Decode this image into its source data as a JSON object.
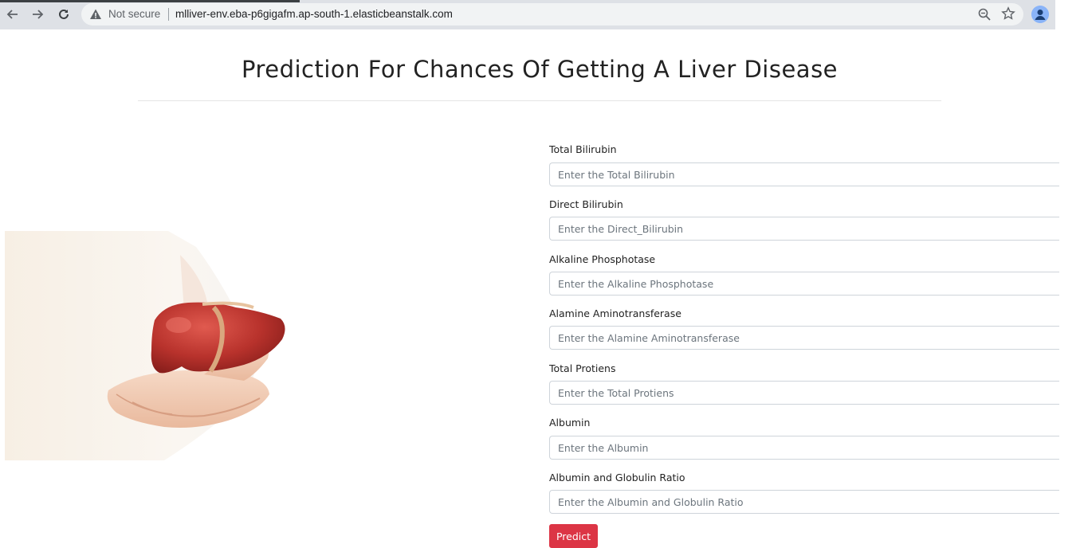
{
  "browser": {
    "security_label": "Not secure",
    "url": "mlliver-env.eba-p6gigafm.ap-south-1.elasticbeanstalk.com"
  },
  "page": {
    "title": "Prediction For Chances Of Getting A Liver Disease",
    "fields": [
      {
        "label": "Total Bilirubin",
        "placeholder": "Enter the Total Bilirubin",
        "value": ""
      },
      {
        "label": "Direct Bilirubin",
        "placeholder": "Enter the Direct_Bilirubin",
        "value": ""
      },
      {
        "label": "Alkaline Phosphotase",
        "placeholder": "Enter the Alkaline Phosphotase",
        "value": ""
      },
      {
        "label": "Alamine Aminotransferase",
        "placeholder": "Enter the Alamine Aminotransferase",
        "value": ""
      },
      {
        "label": "Total Protiens",
        "placeholder": "Enter the Total Protiens",
        "value": ""
      },
      {
        "label": "Albumin",
        "placeholder": "Enter the Albumin",
        "value": ""
      },
      {
        "label": "Albumin and Globulin Ratio",
        "placeholder": "Enter the Albumin and Globulin Ratio",
        "value": ""
      }
    ],
    "submit_label": "Predict"
  },
  "colors": {
    "predict_button": "#dc3545",
    "chrome_bar": "#dee1e6",
    "liver": "#c0392b"
  },
  "icons": [
    "back-arrow-icon",
    "forward-arrow-icon",
    "reload-icon",
    "warning-icon",
    "zoom-icon",
    "star-icon",
    "profile-icon"
  ]
}
